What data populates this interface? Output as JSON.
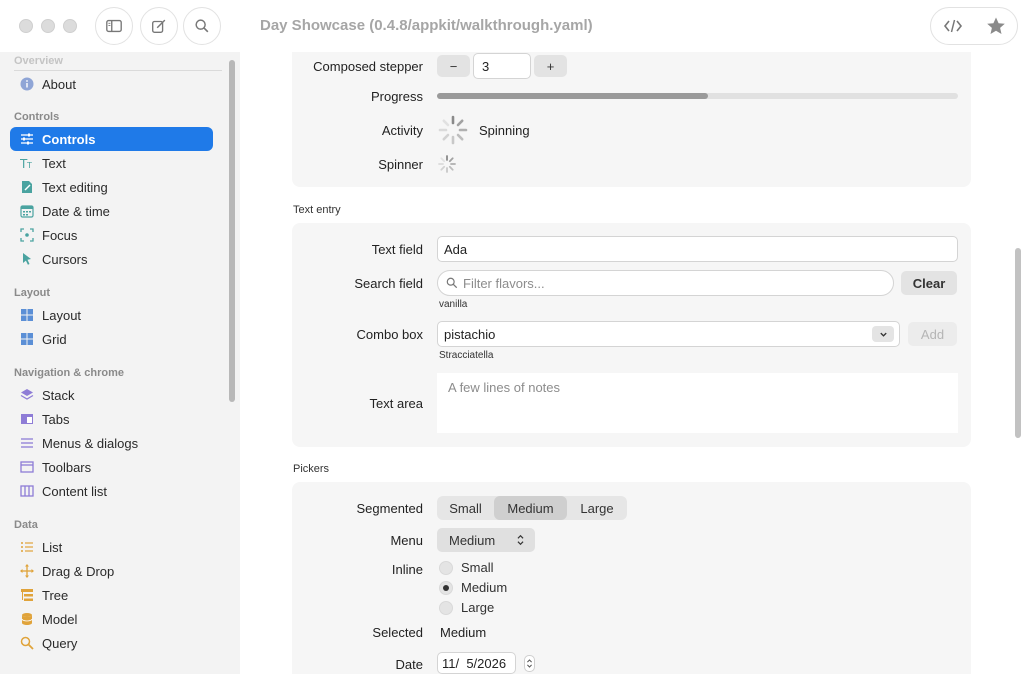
{
  "window": {
    "title": "Day Showcase (0.4.8/appkit/walkthrough.yaml)"
  },
  "sidebar": {
    "sections": {
      "overview": "Overview",
      "controls": "Controls",
      "layout": "Layout",
      "navigation": "Navigation & chrome",
      "data": "Data"
    },
    "items": {
      "about": "About",
      "controls": "Controls",
      "text": "Text",
      "text_editing": "Text editing",
      "date_time": "Date & time",
      "focus": "Focus",
      "cursors": "Cursors",
      "layout": "Layout",
      "grid": "Grid",
      "stack": "Stack",
      "tabs": "Tabs",
      "menus": "Menus & dialogs",
      "toolbars": "Toolbars",
      "content_list": "Content list",
      "list": "List",
      "drag_drop": "Drag & Drop",
      "tree": "Tree",
      "model": "Model",
      "query": "Query"
    },
    "icons": {
      "about": "info-icon",
      "controls": "sliders-icon",
      "text": "text-icon",
      "text_editing": "document-edit-icon",
      "date_time": "calendar-icon",
      "focus": "focus-icon",
      "cursors": "cursor-icon",
      "layout": "grid-icon",
      "grid": "grid-icon",
      "stack": "stack-icon",
      "tabs": "tabs-icon",
      "menus": "menu-icon",
      "toolbars": "toolbar-icon",
      "content_list": "columns-icon",
      "list": "list-icon",
      "drag_drop": "move-icon",
      "tree": "tree-icon",
      "model": "database-icon",
      "query": "search-icon"
    },
    "colors": {
      "accent": "#1f7ae8"
    }
  },
  "controls_group": {
    "stepper": {
      "label": "Composed stepper",
      "minus": "−",
      "value": "3",
      "plus": "+"
    },
    "progress": {
      "label": "Progress",
      "fraction": 0.52
    },
    "activity": {
      "label": "Activity",
      "status": "Spinning"
    },
    "spinner": {
      "label": "Spinner"
    }
  },
  "text_entry": {
    "section_title": "Text entry",
    "text_field": {
      "label": "Text field",
      "value": "Ada"
    },
    "search_field": {
      "label": "Search field",
      "placeholder": "Filter flavors...",
      "clear": "Clear",
      "caption": "vanilla"
    },
    "combo_box": {
      "label": "Combo box",
      "value": "pistachio",
      "add": "Add",
      "caption": "Stracciatella"
    },
    "text_area": {
      "label": "Text area",
      "placeholder": "A few lines of notes"
    }
  },
  "pickers": {
    "section_title": "Pickers",
    "segmented": {
      "label": "Segmented",
      "options": [
        "Small",
        "Medium",
        "Large"
      ],
      "selected": "Medium"
    },
    "menu": {
      "label": "Menu",
      "value": "Medium"
    },
    "inline": {
      "label": "Inline",
      "options": [
        "Small",
        "Medium",
        "Large"
      ],
      "selected": "Medium"
    },
    "selected": {
      "label": "Selected",
      "value": "Medium"
    },
    "date": {
      "label": "Date",
      "value": "11/  5/2026"
    }
  }
}
